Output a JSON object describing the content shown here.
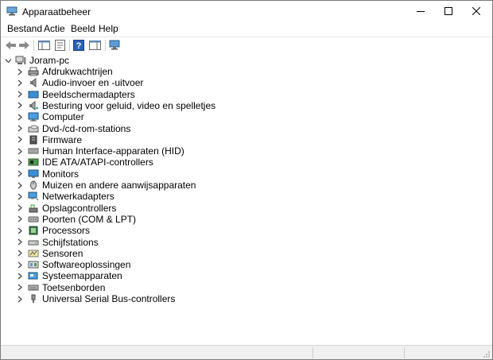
{
  "window": {
    "title": "Apparaatbeheer"
  },
  "menu": {
    "items": [
      "Bestand",
      "Actie",
      "Beeld",
      "Help"
    ]
  },
  "tree": {
    "root": "Joram-pc",
    "categories": [
      "Afdrukwachtrijen",
      "Audio-invoer en -uitvoer",
      "Beeldschermadapters",
      "Besturing voor geluid, video en spelletjes",
      "Computer",
      "Dvd-/cd-rom-stations",
      "Firmware",
      "Human Interface-apparaten (HID)",
      "IDE ATA/ATAPI-controllers",
      "Monitors",
      "Muizen en andere aanwijsapparaten",
      "Netwerkadapters",
      "Opslagcontrollers",
      "Poorten (COM & LPT)",
      "Processors",
      "Schijfstations",
      "Sensoren",
      "Softwareoplossingen",
      "Systeemapparaten",
      "Toetsenborden",
      "Universal Serial Bus-controllers"
    ]
  }
}
